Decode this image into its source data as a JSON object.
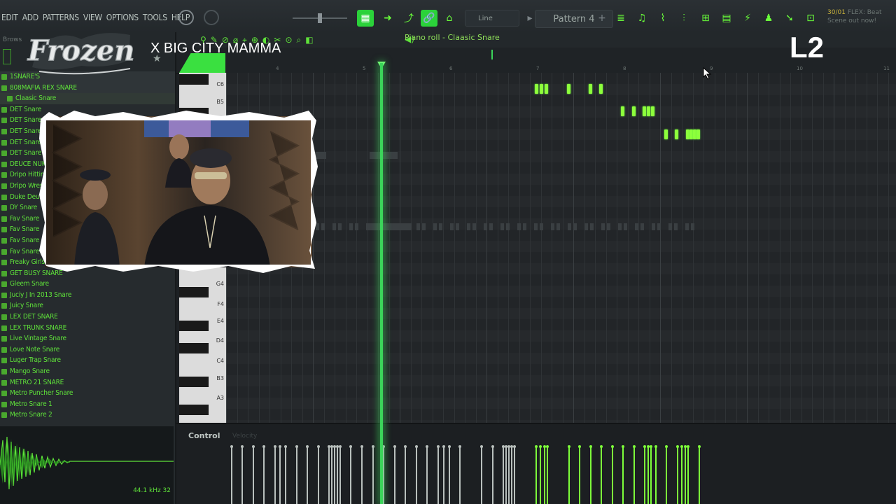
{
  "menu": [
    "EDIT",
    "ADD",
    "PATTERNS",
    "VIEW",
    "OPTIONS",
    "TOOLS",
    "HELP"
  ],
  "toolbar": {
    "pattern": "Pattern 4",
    "plus": "+",
    "snap_mode": "Line",
    "news_time": "30/01",
    "news_text": "FLEX: Beat Scene out now!"
  },
  "browser": {
    "title": "Brows",
    "items": [
      {
        "label": "1SNARE'S",
        "kind": "open"
      },
      {
        "label": "808MAFIA REX SNARE",
        "kind": "open"
      },
      {
        "label": "Claasic Snare",
        "kind": "sub"
      },
      {
        "label": "DET Snare",
        "kind": "normal"
      },
      {
        "label": "DET Snare",
        "kind": "normal"
      },
      {
        "label": "DET Snare",
        "kind": "normal"
      },
      {
        "label": "DET Snare",
        "kind": "normal"
      },
      {
        "label": "DET Snare",
        "kind": "normal"
      },
      {
        "label": "DEUCE NUK",
        "kind": "normal"
      },
      {
        "label": "Dripo Hittin",
        "kind": "normal"
      },
      {
        "label": "Dripo Wrest",
        "kind": "normal"
      },
      {
        "label": "Duke Deuce",
        "kind": "normal"
      },
      {
        "label": "DY Snare",
        "kind": "normal"
      },
      {
        "label": "Fav Snare",
        "kind": "normal"
      },
      {
        "label": "Fav Snare",
        "kind": "normal"
      },
      {
        "label": "Fav Snare",
        "kind": "normal"
      },
      {
        "label": "Fav Snare",
        "kind": "normal"
      },
      {
        "label": "Freaky Girls",
        "kind": "normal"
      },
      {
        "label": "GET BUSY SNARE",
        "kind": "normal"
      },
      {
        "label": "Gleem Snare",
        "kind": "normal"
      },
      {
        "label": "Juciy J In 2013 Snare",
        "kind": "normal"
      },
      {
        "label": "Juicy Snare",
        "kind": "normal"
      },
      {
        "label": "LEX DET SNARE",
        "kind": "normal"
      },
      {
        "label": "LEX TRUNK SNARE",
        "kind": "normal"
      },
      {
        "label": "Live Vintage Snare",
        "kind": "normal"
      },
      {
        "label": "Love Note Snare",
        "kind": "normal"
      },
      {
        "label": "Luger Trap Snare",
        "kind": "normal"
      },
      {
        "label": "Mango Snare",
        "kind": "normal"
      },
      {
        "label": "METRO 21 SNARE",
        "kind": "normal"
      },
      {
        "label": "Metro Puncher Snare",
        "kind": "normal"
      },
      {
        "label": "Metro Snare 1",
        "kind": "normal"
      },
      {
        "label": "Metro Snare 2",
        "kind": "normal"
      }
    ],
    "sample_info": "44.1 kHz 32"
  },
  "piano_roll": {
    "title": "Piano roll - Claasic Snare",
    "bar_numbers": [
      "4",
      "5",
      "6",
      "7",
      "8",
      "9",
      "10",
      "11"
    ],
    "key_labels": [
      "C6",
      "B5",
      "G4",
      "F4",
      "E4",
      "D4",
      "C4",
      "B3",
      "A3"
    ],
    "control_label": "Control",
    "control_sub": "Velocity"
  },
  "overlay": {
    "logo_text": "Frozen",
    "collab_text": "X BIG CITY MAMMA",
    "corner_tag": "L2"
  },
  "colors": {
    "accent": "#5fe23a",
    "note": "#8dff3c",
    "playhead": "#3bd45a",
    "background": "#1d2124"
  }
}
